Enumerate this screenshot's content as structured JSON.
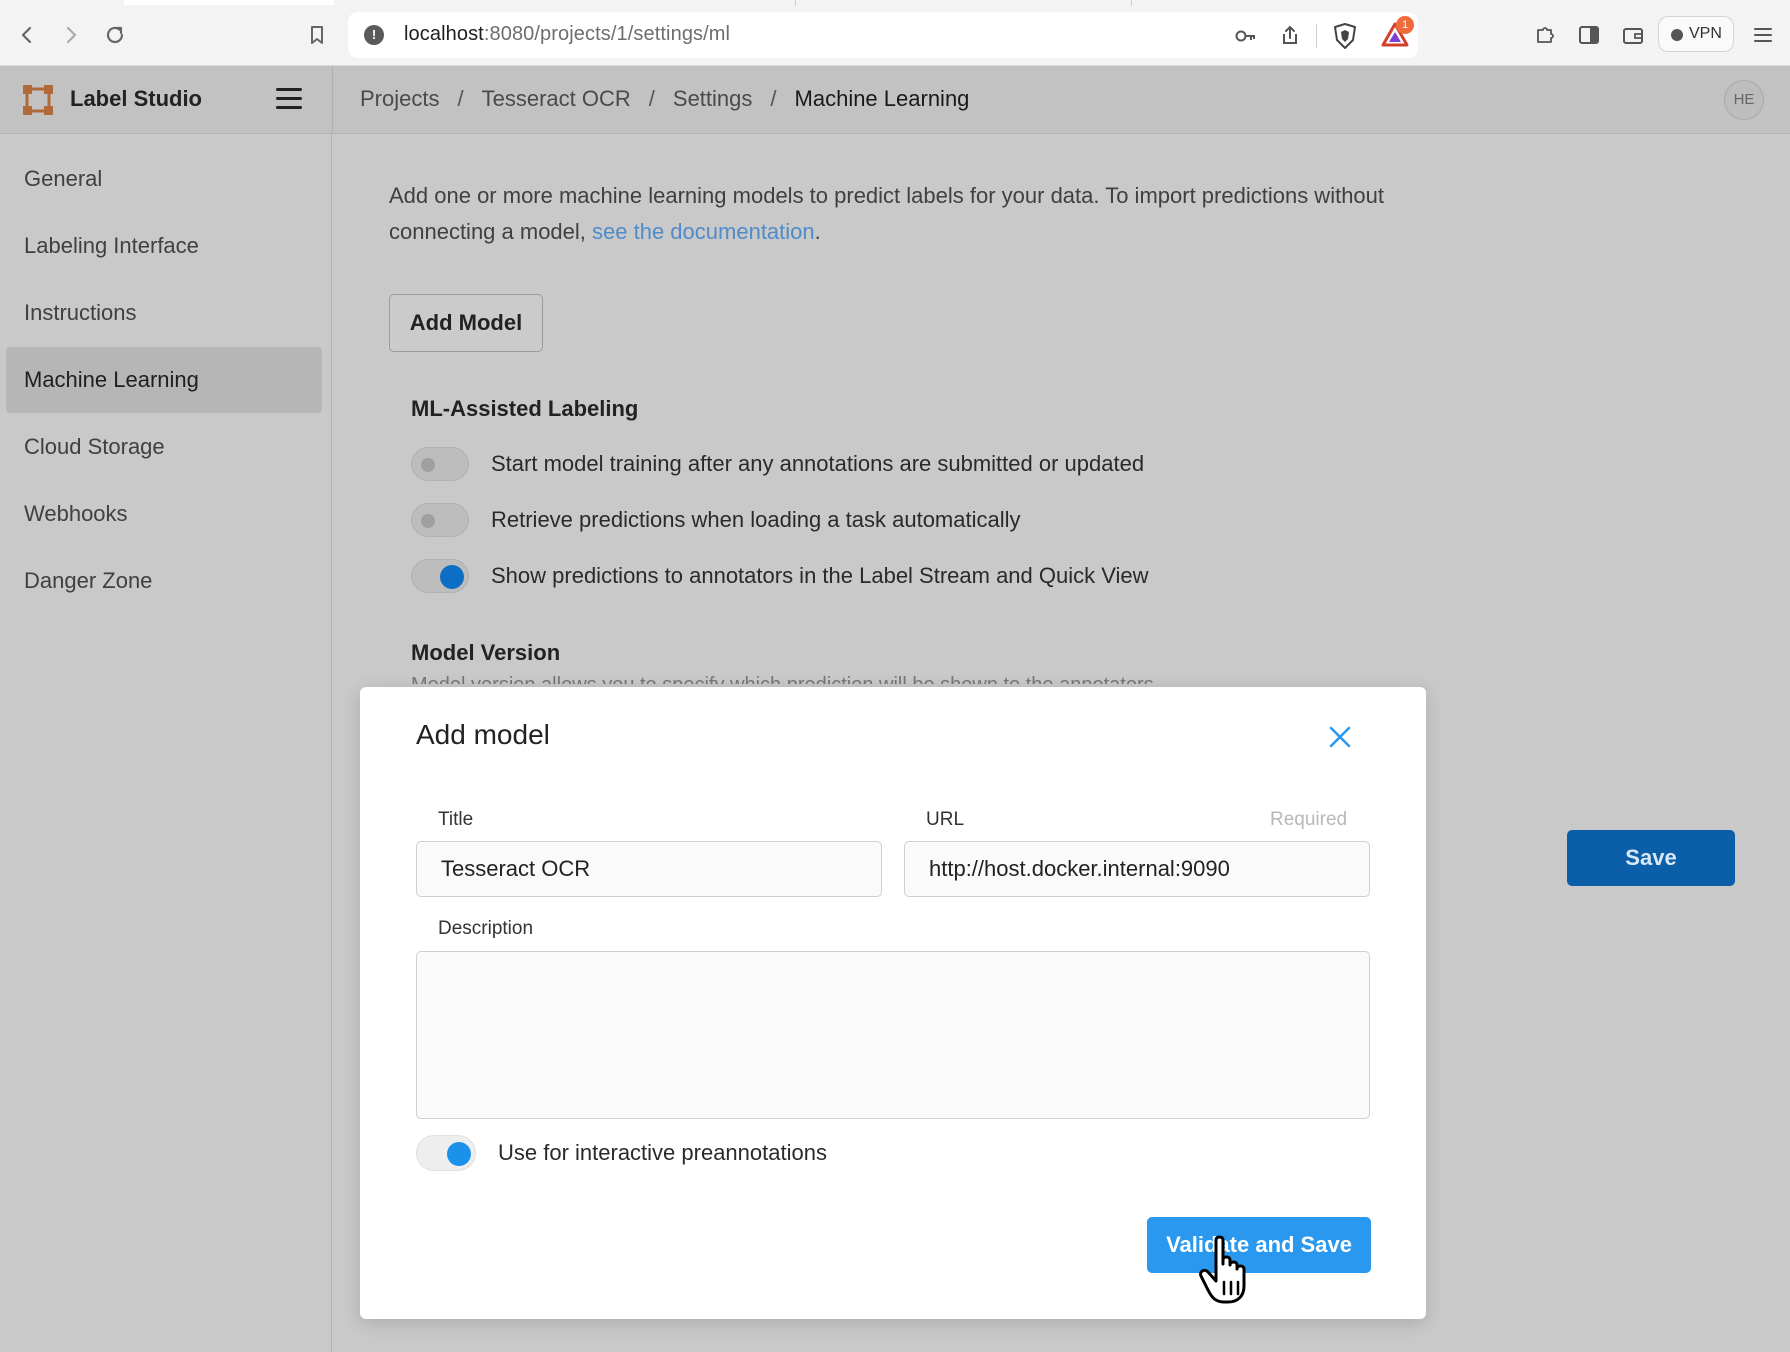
{
  "browser": {
    "url_host": "localhost",
    "url_path": ":8080/projects/1/settings/ml",
    "rewards_badge": "1",
    "vpn_label": "VPN",
    "icons": [
      "back-icon",
      "forward-icon",
      "reload-icon",
      "bookmark-icon",
      "site-info-icon",
      "key-icon",
      "share-icon",
      "brave-shields-icon",
      "brave-rewards-icon",
      "extensions-icon",
      "sidebar-icon",
      "wallet-icon",
      "menu-icon"
    ]
  },
  "app": {
    "brand": "Label Studio",
    "avatar": "HE",
    "breadcrumb": {
      "items": [
        "Projects",
        "Tesseract OCR",
        "Settings"
      ],
      "current": "Machine Learning",
      "separator": "/"
    }
  },
  "sidebar": {
    "items": [
      {
        "label": "General",
        "active": false
      },
      {
        "label": "Labeling Interface",
        "active": false
      },
      {
        "label": "Instructions",
        "active": false
      },
      {
        "label": "Machine Learning",
        "active": true
      },
      {
        "label": "Cloud Storage",
        "active": false
      },
      {
        "label": "Webhooks",
        "active": false
      },
      {
        "label": "Danger Zone",
        "active": false
      }
    ]
  },
  "main": {
    "intro_text": "Add one or more machine learning models to predict labels for your data. To import predictions without connecting a model,",
    "intro_link": "see the documentation",
    "intro_end": ".",
    "add_model_label": "Add Model",
    "ml_assisted_title": "ML-Assisted Labeling",
    "toggles": [
      {
        "label": "Start model training after any annotations are submitted or updated",
        "on": false
      },
      {
        "label": "Retrieve predictions when loading a task automatically",
        "on": false
      },
      {
        "label": "Show predictions to annotators in the Label Stream and Quick View",
        "on": true
      }
    ],
    "model_version_title": "Model Version",
    "model_version_desc": "Model version allows you to specify which prediction will be shown to the annotators.",
    "save_label": "Save"
  },
  "modal": {
    "title": "Add model",
    "title_label": "Title",
    "title_value": "Tesseract OCR",
    "url_label": "URL",
    "url_required": "Required",
    "url_value": "http://host.docker.internal:9090",
    "description_label": "Description",
    "description_value": "",
    "interactive_label": "Use for interactive preannotations",
    "interactive_on": true,
    "validate_label": "Validate and Save"
  },
  "colors": {
    "accent": "#2a98ee",
    "save": "#0b5fa8",
    "link": "#4f8bc9",
    "toggle_on": "#0d6ec5"
  }
}
